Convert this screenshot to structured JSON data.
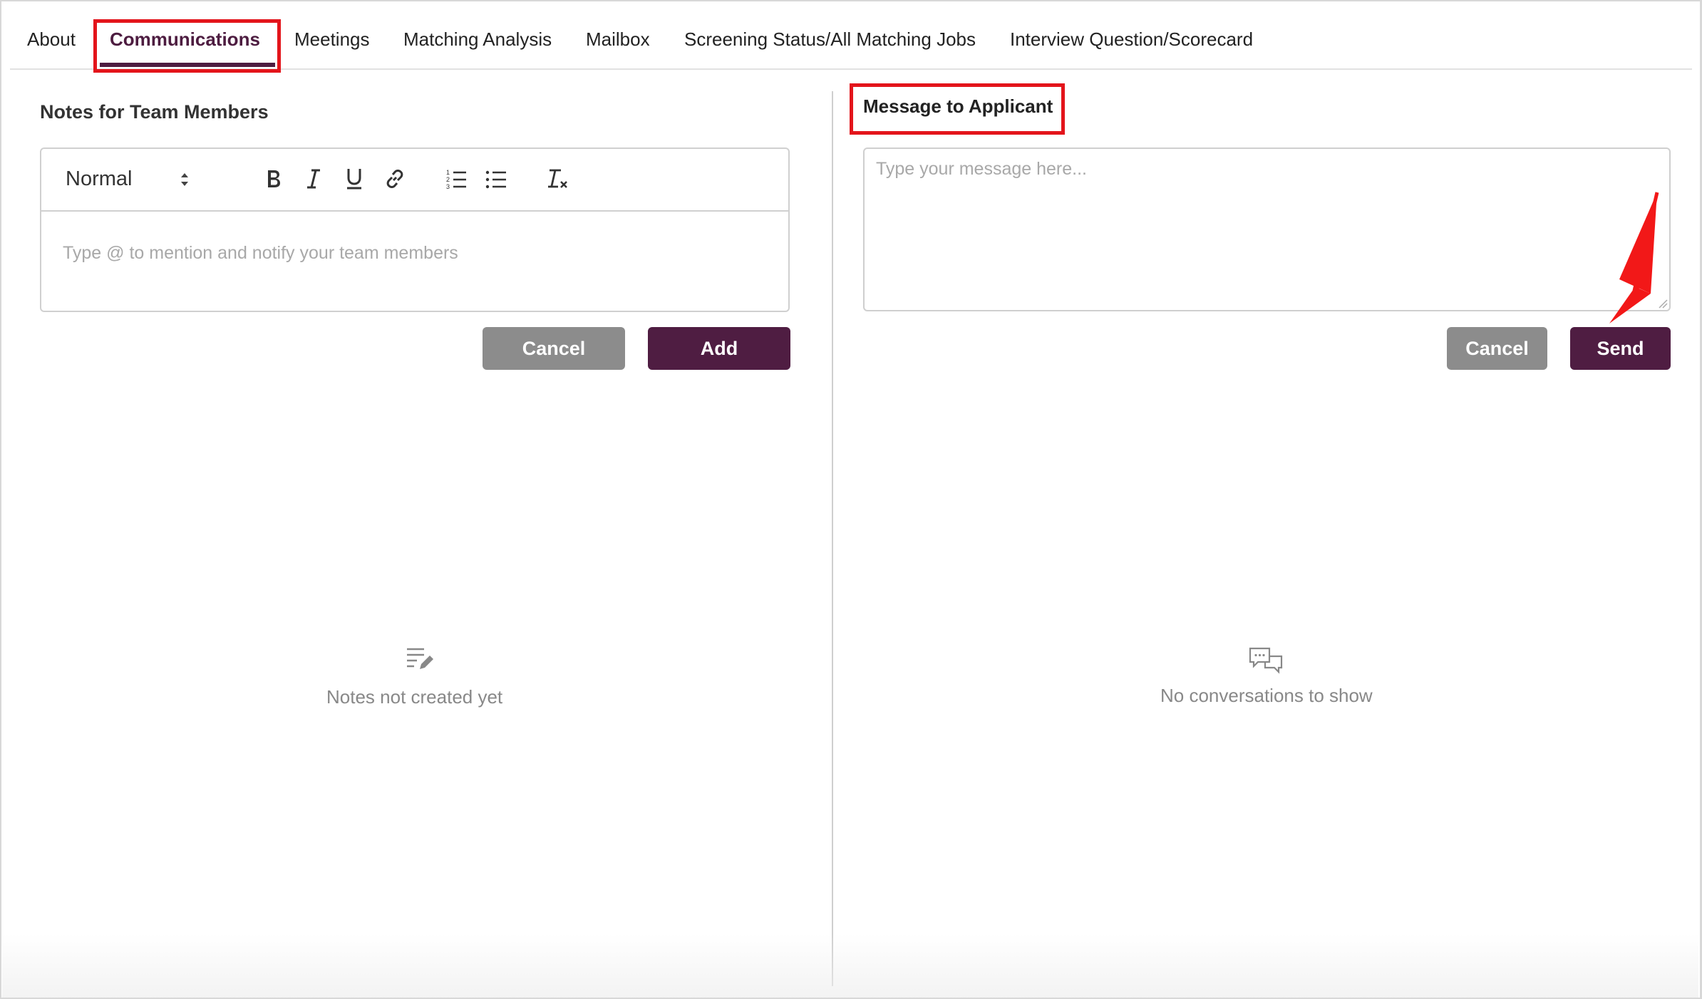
{
  "tabs": [
    {
      "label": "About"
    },
    {
      "label": "Communications"
    },
    {
      "label": "Meetings"
    },
    {
      "label": "Matching Analysis"
    },
    {
      "label": "Mailbox"
    },
    {
      "label": "Screening Status/All Matching Jobs"
    },
    {
      "label": "Interview Question/Scorecard"
    }
  ],
  "notes": {
    "title": "Notes for Team Members",
    "format_select": "Normal",
    "placeholder": "Type @ to mention and notify your team members",
    "cancel_label": "Cancel",
    "add_label": "Add",
    "empty_text": "Notes not created yet"
  },
  "message": {
    "title": "Message to Applicant",
    "placeholder": "Type your message here...",
    "cancel_label": "Cancel",
    "send_label": "Send",
    "empty_text": "No conversations to show"
  },
  "colors": {
    "accent": "#4f1d42",
    "highlight": "#e3141b",
    "button_gray": "#8c8c8c"
  },
  "icons": [
    "bold-icon",
    "italic-icon",
    "underline-icon",
    "link-icon",
    "ordered-list-icon",
    "bullet-list-icon",
    "clear-format-icon",
    "notes-edit-icon",
    "chat-bubbles-icon",
    "annotation-arrow"
  ]
}
